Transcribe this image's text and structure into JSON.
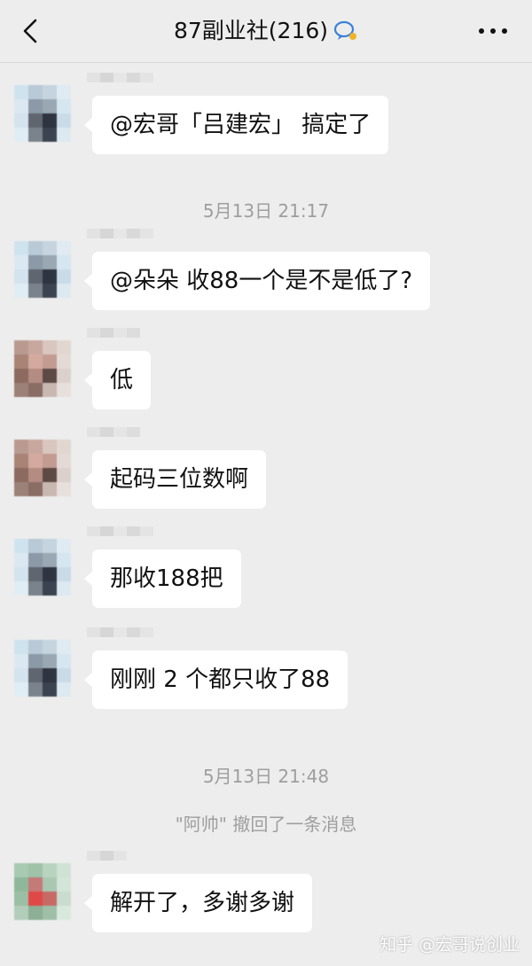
{
  "header": {
    "title": "87副业社",
    "member_count": "(216)",
    "back_icon": "chevron-left-icon",
    "more_icon": "more-dots-icon"
  },
  "messages": [
    {
      "text": "@宏哥「吕建宏」 搞定了"
    },
    {
      "text": "@朵朵 收88一个是不是低了?"
    },
    {
      "text": "低"
    },
    {
      "text": "起码三位数啊"
    },
    {
      "text": "那收188把"
    },
    {
      "text": "刚刚 2 个都只收了88"
    },
    {
      "text": "解开了，多谢多谢"
    }
  ],
  "timestamps": [
    "5月13日 21:17",
    "5月13日 21:48"
  ],
  "recall_notice": "\"阿帅\" 撤回了一条消息",
  "watermark": "知乎 @宏哥说创业",
  "colors": {
    "background": "#ededed",
    "bubble": "#ffffff",
    "system_text": "#9e9e9e"
  }
}
